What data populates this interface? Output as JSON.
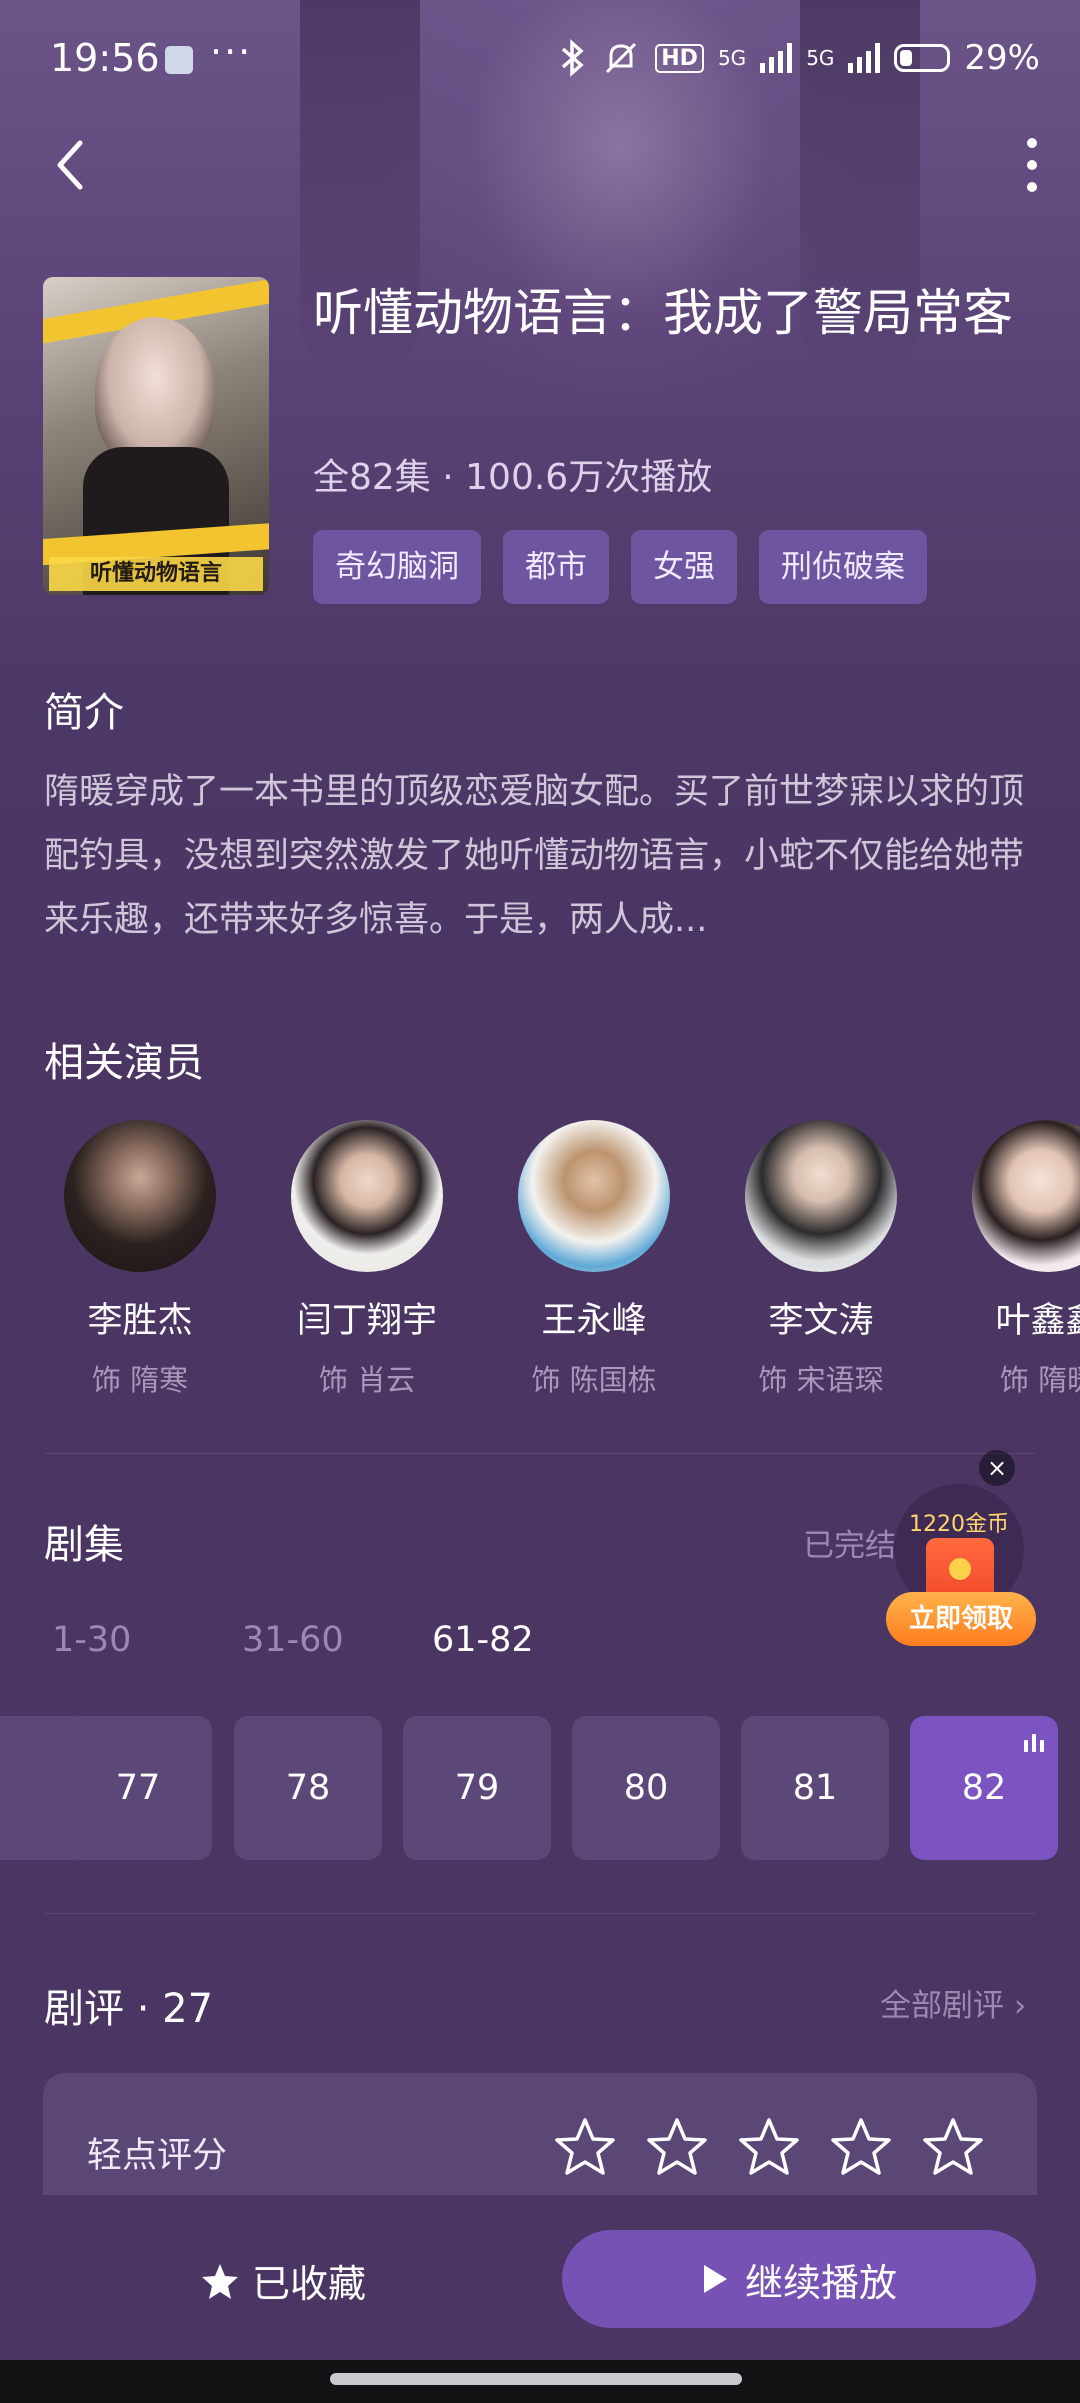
{
  "status_bar": {
    "time": "19:56",
    "dots": "···",
    "hd": "HD",
    "net1": "5G",
    "net2": "5G",
    "battery": "29%"
  },
  "drama": {
    "title": "听懂动物语言：我成了警局常客",
    "meta": "全82集 · 100.6万次播放",
    "poster_title": "听懂动物语言",
    "tags": [
      "奇幻脑洞",
      "都市",
      "女强",
      "刑侦破案"
    ]
  },
  "intro": {
    "heading": "简介",
    "text": "隋暖穿成了一本书里的顶级恋爱脑女配。买了前世梦寐以求的顶配钓具，没想到突然激发了她听懂动物语言，小蛇不仅能给她带来乐趣，还带来好多惊喜。于是，两人成..."
  },
  "actors": {
    "heading": "相关演员",
    "items": [
      {
        "name": "李胜杰",
        "role": "饰 隋寒"
      },
      {
        "name": "闫丁翔宇",
        "role": "饰 肖云"
      },
      {
        "name": "王永峰",
        "role": "饰 陈国栋"
      },
      {
        "name": "李文涛",
        "role": "饰 宋语琛"
      },
      {
        "name": "叶鑫鑫",
        "role": "饰 隋暖"
      }
    ]
  },
  "episodes": {
    "heading": "剧集",
    "status": "已完结",
    "ranges": [
      "1-30",
      "31-60",
      "61-82"
    ],
    "active_range": "61-82",
    "numbers": [
      "77",
      "78",
      "79",
      "80",
      "81",
      "82"
    ],
    "playing": "82"
  },
  "reward": {
    "coins": "1220金币",
    "button": "立即领取",
    "close": "×"
  },
  "reviews": {
    "heading": "剧评 · 27",
    "all_link": "全部剧评 ›",
    "rate_label": "轻点评分",
    "stars_total": 5,
    "stars_filled": 0
  },
  "bottom": {
    "collected": "已收藏",
    "play": "继续播放"
  },
  "colors": {
    "accent": "#7752b5",
    "background": "#4a3563",
    "tag_bg": "#6e55a0"
  }
}
